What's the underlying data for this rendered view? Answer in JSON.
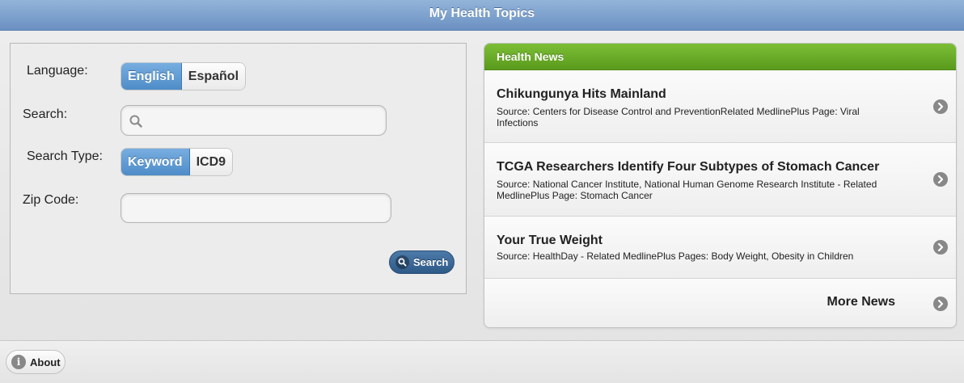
{
  "header": {
    "title": "My Health Topics"
  },
  "form": {
    "language_label": "Language:",
    "language_options": [
      "English",
      "Español"
    ],
    "search_label": "Search:",
    "search_value": "",
    "search_type_label": "Search Type:",
    "search_type_options": [
      "Keyword",
      "ICD9"
    ],
    "zip_label": "Zip Code:",
    "zip_value": "",
    "search_button": "Search"
  },
  "news": {
    "title": "Health News",
    "items": [
      {
        "title": "Chikungunya Hits Mainland",
        "source": "Source: Centers for Disease Control and PreventionRelated MedlinePlus Page: Viral Infections"
      },
      {
        "title": "TCGA Researchers Identify Four Subtypes of Stomach Cancer",
        "source": "Source: National Cancer Institute, National Human Genome Research Institute - Related MedlinePlus Page: Stomach Cancer"
      },
      {
        "title": "Your True Weight",
        "source": "Source: HealthDay - Related MedlinePlus Pages: Body Weight, Obesity in Children"
      }
    ],
    "more_label": "More News"
  },
  "footer": {
    "about_label": "About"
  },
  "colors": {
    "header": "#7aa0cf",
    "news_header": "#6aae29",
    "segment_selected": "#5d97ce",
    "search_button": "#3b6795"
  },
  "icons": {
    "search_field": "magnifier-icon",
    "search_button": "magnifier-icon",
    "disclosure": "chevron-right-circle-icon",
    "about": "info-icon"
  }
}
